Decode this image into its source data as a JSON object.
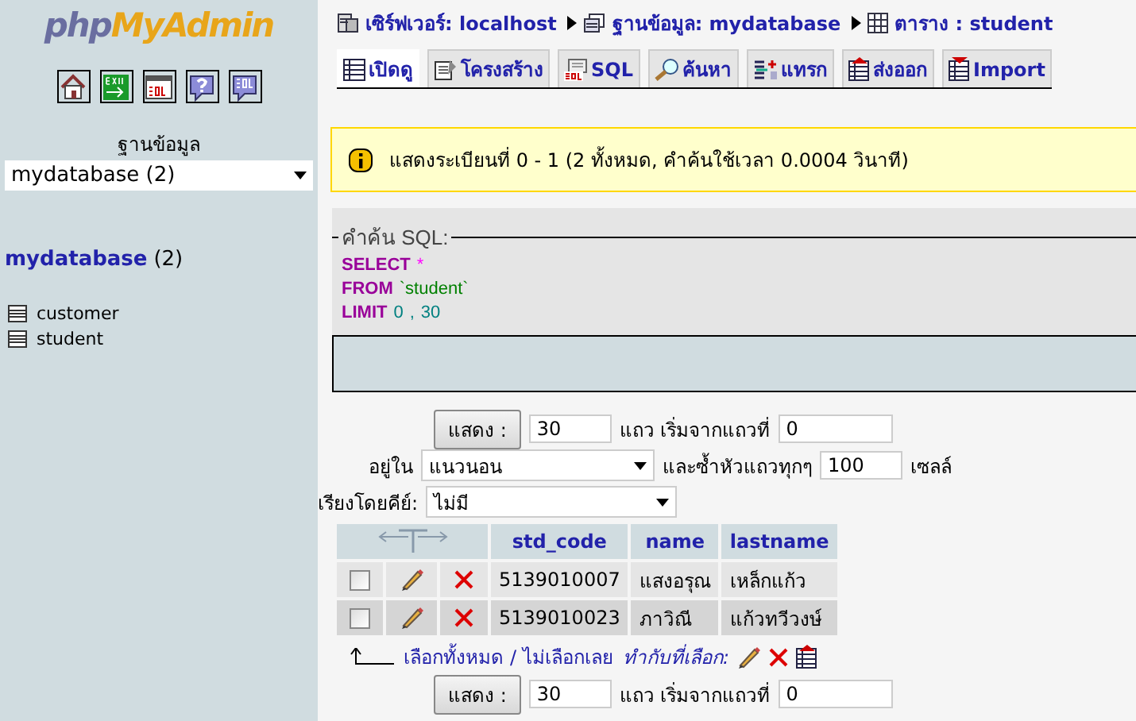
{
  "sidebar": {
    "logo_left": "php",
    "logo_right": "MyAdmin",
    "database_label": "ฐานข้อมูล",
    "database_select": "mydatabase (2)",
    "database_link": "mydatabase",
    "database_count": "(2)",
    "tables": [
      "customer",
      "student"
    ]
  },
  "breadcrumb": [
    "เซิร์ฟเวอร์: localhost",
    "ฐานข้อมูล: mydatabase",
    "ตาราง : student"
  ],
  "tabs": [
    {
      "label": "เปิดดู",
      "selected": true
    },
    {
      "label": "โครงสร้าง",
      "selected": false
    },
    {
      "label": "SQL",
      "selected": false
    },
    {
      "label": "ค้นหา",
      "selected": false
    },
    {
      "label": "แทรก",
      "selected": false
    },
    {
      "label": "ส่งออก",
      "selected": false
    },
    {
      "label": "Import",
      "selected": false
    }
  ],
  "notice": "แสดงระเบียนที่ 0 - 1 (2 ทั้งหมด, คำค้นใช้เวลา 0.0004 วินาที)",
  "sql": {
    "legend": "คำค้น SQL:",
    "lines": [
      [
        {
          "kind": "keyword",
          "text": "SELECT"
        },
        {
          "kind": "symbol",
          "text": "*"
        }
      ],
      [
        {
          "kind": "keyword",
          "text": "FROM"
        },
        {
          "kind": "string",
          "text": "`student`"
        }
      ],
      [
        {
          "kind": "keyword",
          "text": "LIMIT"
        },
        {
          "kind": "number",
          "text": "0"
        },
        {
          "kind": "number",
          "text": ","
        },
        {
          "kind": "number",
          "text": "30"
        }
      ]
    ]
  },
  "navigation": {
    "show_button": "แสดง :",
    "rows": "30",
    "rows_label": "แถว เริ่มจากแถวที่",
    "start": "0",
    "mode_label": "อยู่ใน",
    "mode": "แนวนอน",
    "repeat_label": "และซ้ำหัวแถวทุกๆ",
    "repeat": "100",
    "cells_label": "เซลล์",
    "sort_label": "เรียงโดยคีย์:",
    "sort": "ไม่มี"
  },
  "table": {
    "columns": [
      "std_code",
      "name",
      "lastname"
    ],
    "rows": [
      {
        "checked": false,
        "cells": [
          "5139010007",
          "แสงอรุณ",
          "เหล็กแก้ว"
        ]
      },
      {
        "checked": false,
        "cells": [
          "5139010023",
          "ภาวิณี",
          "แก้วทวีวงษ์"
        ]
      }
    ]
  },
  "footer": {
    "select_all": "เลือกทั้งหมด",
    "separator": "/",
    "select_none": "ไม่เลือกเลย",
    "with_selected": "ทำกับที่เลือก:"
  },
  "navigation_bottom": {
    "show_button": "แสดง :",
    "rows": "30",
    "rows_label": "แถว เริ่มจากแถวที่",
    "start": "0"
  }
}
